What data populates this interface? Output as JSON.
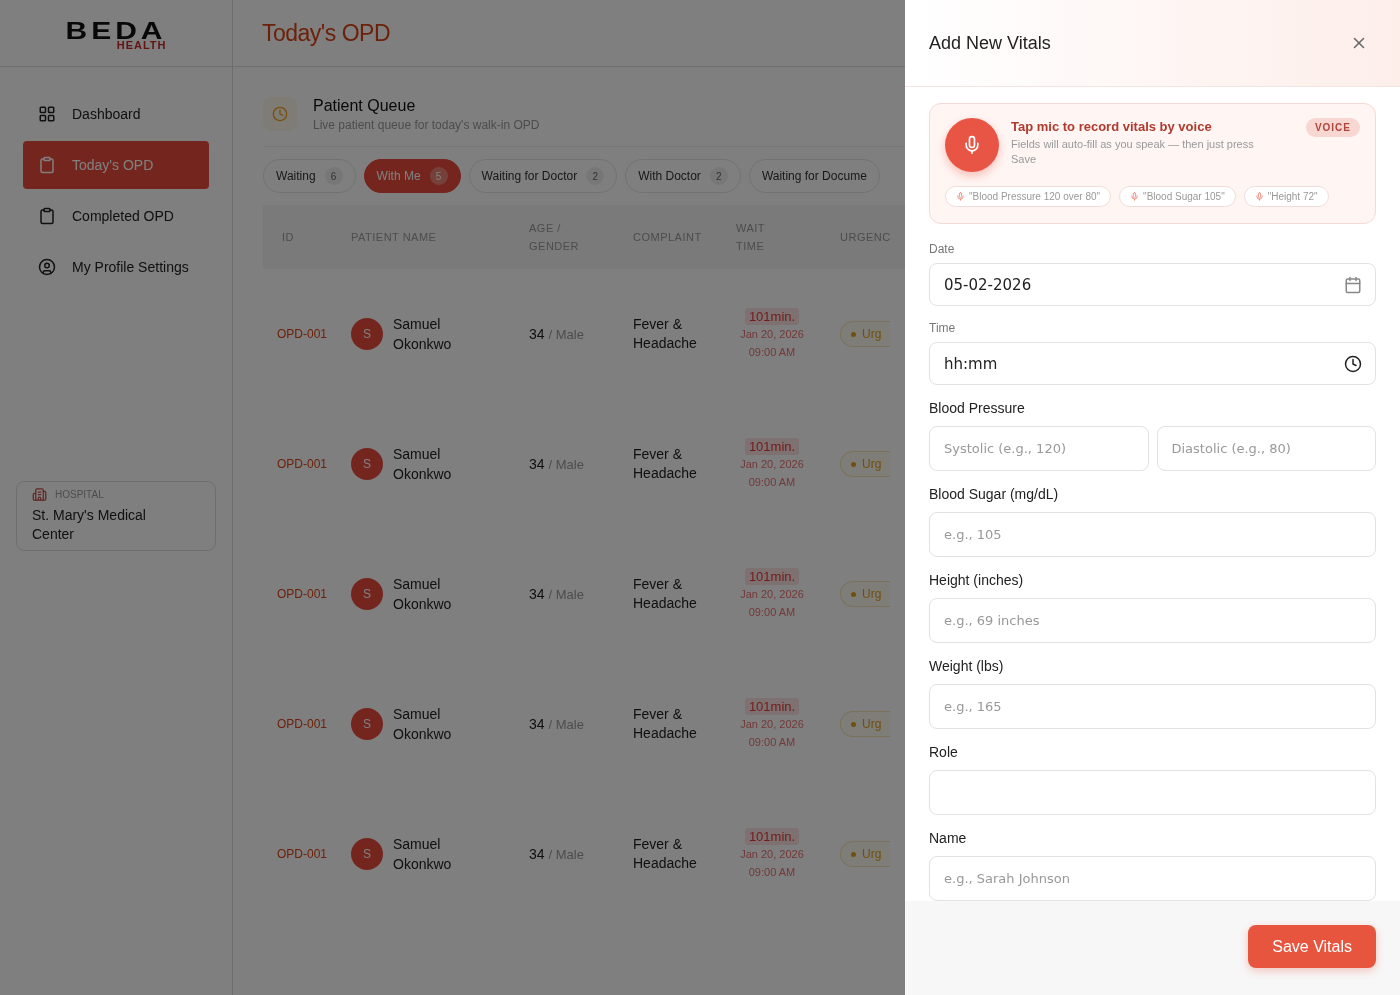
{
  "logo": {
    "word": "BEDA",
    "sub": "HEALTH"
  },
  "page_title": "Today's OPD",
  "sidebar": {
    "items": [
      {
        "label": "Dashboard",
        "selected": false
      },
      {
        "label": "Today's OPD",
        "selected": true
      },
      {
        "label": "Completed OPD",
        "selected": false
      },
      {
        "label": "My Profile Settings",
        "selected": false
      }
    ],
    "hospital": {
      "label": "HOSPITAL",
      "name": "St. Mary's Medical Center"
    }
  },
  "queue": {
    "title": "Patient Queue",
    "subtitle": "Live patient queue for today's walk-in OPD"
  },
  "tabs": [
    {
      "label": "Waiting",
      "count": "6",
      "selected": false
    },
    {
      "label": "With Me",
      "count": "5",
      "selected": true
    },
    {
      "label": "Waiting for Doctor",
      "count": "2",
      "selected": false
    },
    {
      "label": "With Doctor",
      "count": "2",
      "selected": false
    },
    {
      "label": "Waiting for Docume",
      "selected": false
    }
  ],
  "table": {
    "columns": [
      "ID",
      "PATIENT NAME",
      "AGE / GENDER",
      "COMPLAINT",
      "WAIT TIME",
      "URGENC"
    ],
    "rows": [
      {
        "id": "OPD-001",
        "initial": "S",
        "name": "Samuel Okonkwo",
        "age": "34",
        "gender": "/ Male",
        "complaint": "Fever & Headache",
        "wait": "101min.",
        "date": "Jan 20, 2026",
        "time": "09:00 AM",
        "urgency": "Urg"
      },
      {
        "id": "OPD-001",
        "initial": "S",
        "name": "Samuel Okonkwo",
        "age": "34",
        "gender": "/ Male",
        "complaint": "Fever & Headache",
        "wait": "101min.",
        "date": "Jan 20, 2026",
        "time": "09:00 AM",
        "urgency": "Urg"
      },
      {
        "id": "OPD-001",
        "initial": "S",
        "name": "Samuel Okonkwo",
        "age": "34",
        "gender": "/ Male",
        "complaint": "Fever & Headache",
        "wait": "101min.",
        "date": "Jan 20, 2026",
        "time": "09:00 AM",
        "urgency": "Urg"
      },
      {
        "id": "OPD-001",
        "initial": "S",
        "name": "Samuel Okonkwo",
        "age": "34",
        "gender": "/ Male",
        "complaint": "Fever & Headache",
        "wait": "101min.",
        "date": "Jan 20, 2026",
        "time": "09:00 AM",
        "urgency": "Urg"
      },
      {
        "id": "OPD-001",
        "initial": "S",
        "name": "Samuel Okonkwo",
        "age": "34",
        "gender": "/ Male",
        "complaint": "Fever & Headache",
        "wait": "101min.",
        "date": "Jan 20, 2026",
        "time": "09:00 AM",
        "urgency": "Urg"
      }
    ]
  },
  "drawer": {
    "title": "Add New Vitals",
    "voice": {
      "title": "Tap mic to record vitals by voice",
      "description": "Fields will auto-fill as you speak — then just press Save",
      "badge": "VOICE",
      "chips": [
        "\"Blood Pressure 120 over 80\"",
        "\"Blood Sugar  105\"",
        "\"Height 72\""
      ]
    },
    "fields": [
      {
        "kind": "date",
        "label": "Date",
        "value": "05-02-2026"
      },
      {
        "kind": "time",
        "label": "Time",
        "value": "hh:mm"
      },
      {
        "kind": "pair",
        "label": "Blood Pressure",
        "placeholders": [
          "Systolic (e.g., 120)",
          "Diastolic (e.g., 80)"
        ]
      },
      {
        "kind": "text",
        "label": "Blood Sugar (mg/dL)",
        "placeholder": "e.g., 105"
      },
      {
        "kind": "text",
        "label": "Height (inches)",
        "placeholder": "e.g., 69 inches"
      },
      {
        "kind": "text",
        "label": "Weight (lbs)",
        "placeholder": "e.g., 165"
      },
      {
        "kind": "text",
        "label": "Role"
      },
      {
        "kind": "text",
        "label": "Name",
        "placeholder": "e.g., Sarah Johnson"
      }
    ],
    "save": "Save Vitals"
  }
}
